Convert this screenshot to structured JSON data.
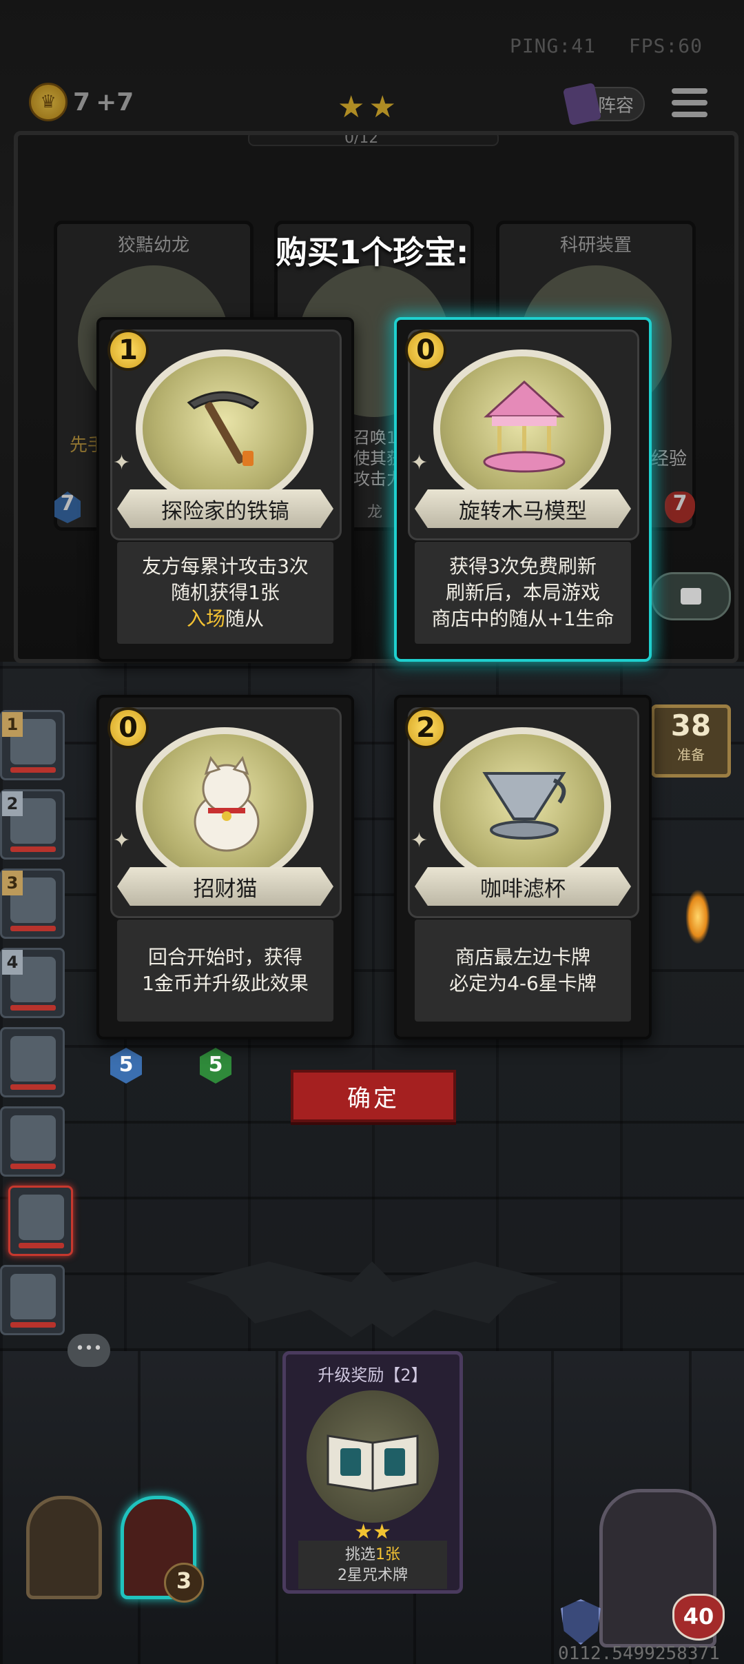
{
  "hud": {
    "ping": "PING:41",
    "fps": "FPS:60",
    "gold": "7",
    "gold_income": "+7",
    "tavern_stars": "★★",
    "tavern_progress_text": "0/12",
    "tavern_progress": 0,
    "lineup_label": "阵容"
  },
  "shop_cards": [
    {
      "name": "狡黠幼龙",
      "tier": "7",
      "peek_text": "先手"
    },
    {
      "name": "",
      "peek_lines": [
        "召唤1",
        "使其获",
        "攻击力"
      ],
      "tribe": "龙"
    },
    {
      "name": "科研装置",
      "hp": "7",
      "peek_text": "经验"
    }
  ],
  "overlay_title": "购买1个珍宝:",
  "treasures": [
    {
      "cost": "1",
      "name": "探险家的铁镐",
      "desc": [
        "友方每累计攻击3次",
        "随机获得1张"
      ],
      "desc_hl": "入场",
      "desc_tail": "随从",
      "icon": "pickaxe-icon",
      "selected": false
    },
    {
      "cost": "0",
      "name": "旋转木马模型",
      "desc": [
        "获得3次免费刷新",
        "刷新后，本局游戏",
        "商店中的随从+1生命"
      ],
      "icon": "carousel-icon",
      "selected": true
    },
    {
      "cost": "0",
      "name": "招财猫",
      "desc": [
        "回合开始时，获得",
        "1金币并升级此效果"
      ],
      "icon": "lucky-cat-icon",
      "selected": false
    },
    {
      "cost": "2",
      "name": "咖啡滤杯",
      "desc": [
        "商店最左边卡牌",
        "必定为4-6星卡牌"
      ],
      "icon": "coffee-dripper-icon",
      "selected": false
    }
  ],
  "confirm_label": "确定",
  "ready": {
    "count": "38",
    "label": "准备"
  },
  "roster": [
    {
      "rank": "1",
      "active": false
    },
    {
      "rank": "2",
      "active": false
    },
    {
      "rank": "3",
      "active": false
    },
    {
      "rank": "4",
      "active": false
    },
    {
      "rank": "",
      "active": false
    },
    {
      "rank": "",
      "active": false
    },
    {
      "rank": "",
      "active": true
    },
    {
      "rank": "",
      "active": false
    }
  ],
  "board_badges": {
    "left": "5",
    "right": "5"
  },
  "upgrade": {
    "header": "升级奖励【2】",
    "stars": "★★",
    "line1_prefix": "挑选",
    "line1_value": "1张",
    "line2": "2星咒术牌"
  },
  "hero_power_count": "3",
  "player": {
    "health": "40"
  },
  "uid": "0112.5499258371",
  "colors": {
    "selected_glow": "#1fd0cf",
    "confirm": "#a52020",
    "gold": "#f2c232"
  }
}
